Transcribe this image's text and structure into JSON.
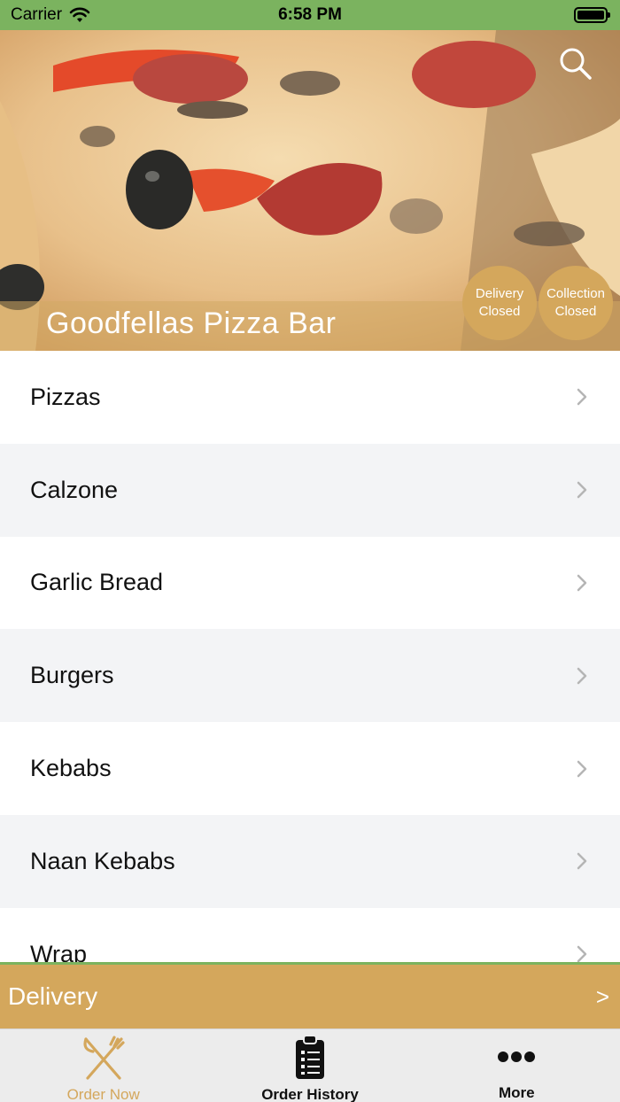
{
  "status_bar": {
    "carrier": "Carrier",
    "time": "6:58 PM"
  },
  "header": {
    "title": "Goodfellas Pizza Bar",
    "badges": [
      {
        "line1": "Delivery",
        "line2": "Closed"
      },
      {
        "line1": "Collection",
        "line2": "Closed"
      }
    ]
  },
  "categories": [
    {
      "label": "Pizzas"
    },
    {
      "label": "Calzone"
    },
    {
      "label": "Garlic Bread"
    },
    {
      "label": "Burgers"
    },
    {
      "label": "Kebabs"
    },
    {
      "label": "Naan Kebabs"
    },
    {
      "label": "Wrap"
    }
  ],
  "order_mode": {
    "label": "Delivery",
    "arrow": ">"
  },
  "tabs": [
    {
      "label": "Order Now",
      "icon": "fork-knife-icon",
      "active": true
    },
    {
      "label": "Order History",
      "icon": "clipboard-list-icon",
      "active": false
    },
    {
      "label": "More",
      "icon": "more-dots-icon",
      "active": false
    }
  ],
  "colors": {
    "accent": "#d4a75c",
    "status_bar": "#7bb35f",
    "row_alt": "#f3f4f6"
  }
}
